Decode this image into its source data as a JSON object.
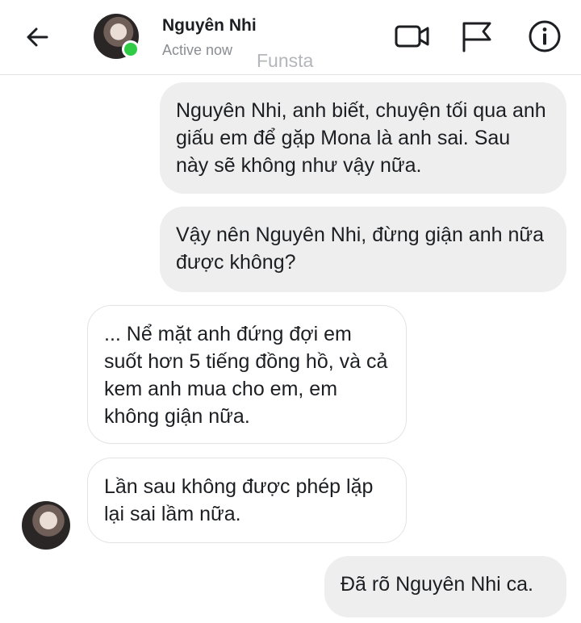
{
  "header": {
    "contact_name": "Nguyên Nhi",
    "status": "Active now",
    "watermark": "Funsta",
    "icons": {
      "back": "arrow-left-icon",
      "video": "video-camera-icon",
      "flag": "flag-icon",
      "info": "info-icon"
    },
    "colors": {
      "online": "#31cc46",
      "name": "#1c1e21",
      "status": "#8a8d91"
    }
  },
  "messages": [
    {
      "direction": "outgoing",
      "text": "Nguyên Nhi, anh biết, chuyện tối qua anh giấu em để gặp Mona là anh sai. Sau này sẽ không như vậy nữa."
    },
    {
      "direction": "outgoing",
      "text": "Vậy nên Nguyên Nhi, đừng giận anh nữa được không?"
    },
    {
      "direction": "incoming",
      "text": "... Nể mặt anh đứng đợi em suốt hơn 5 tiếng đồng hồ, và cả kem anh mua cho em, em không giận nữa."
    },
    {
      "direction": "incoming",
      "text": "Lần sau không được phép lặp lại sai lầm nữa."
    },
    {
      "direction": "outgoing",
      "text": "Đã rõ Nguyên Nhi ca."
    }
  ],
  "colors": {
    "outgoing_bubble": "#eeeeee",
    "incoming_bubble": "#ffffff",
    "incoming_border": "#e3e3e3"
  }
}
